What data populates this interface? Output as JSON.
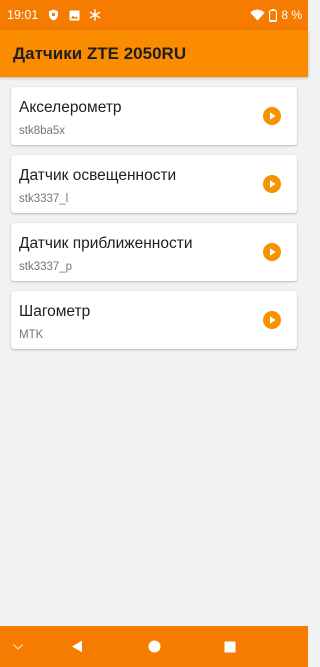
{
  "status_bar": {
    "time": "19:01",
    "battery": "8 %",
    "left_icons": [
      "shield-icon",
      "image-icon",
      "snowflake-icon"
    ],
    "right_icons": [
      "wifi-icon",
      "battery-icon"
    ]
  },
  "app_bar": {
    "title": "Датчики ZTE 2050RU"
  },
  "sensors": [
    {
      "title": "Акселерометр",
      "subtitle": "stk8ba5x"
    },
    {
      "title": "Датчик освещенности",
      "subtitle": "stk3337_l"
    },
    {
      "title": "Датчик приближенности",
      "subtitle": "stk3337_p"
    },
    {
      "title": "Шагометр",
      "subtitle": "MTK"
    }
  ],
  "nav_bar": {
    "items": [
      "chevron-down-icon",
      "back-icon",
      "home-icon",
      "recents-icon"
    ]
  },
  "colors": {
    "status_bar": "#f57c00",
    "app_bar": "#fb8c00",
    "accent": "#f59300",
    "background": "#f2f2f2"
  }
}
